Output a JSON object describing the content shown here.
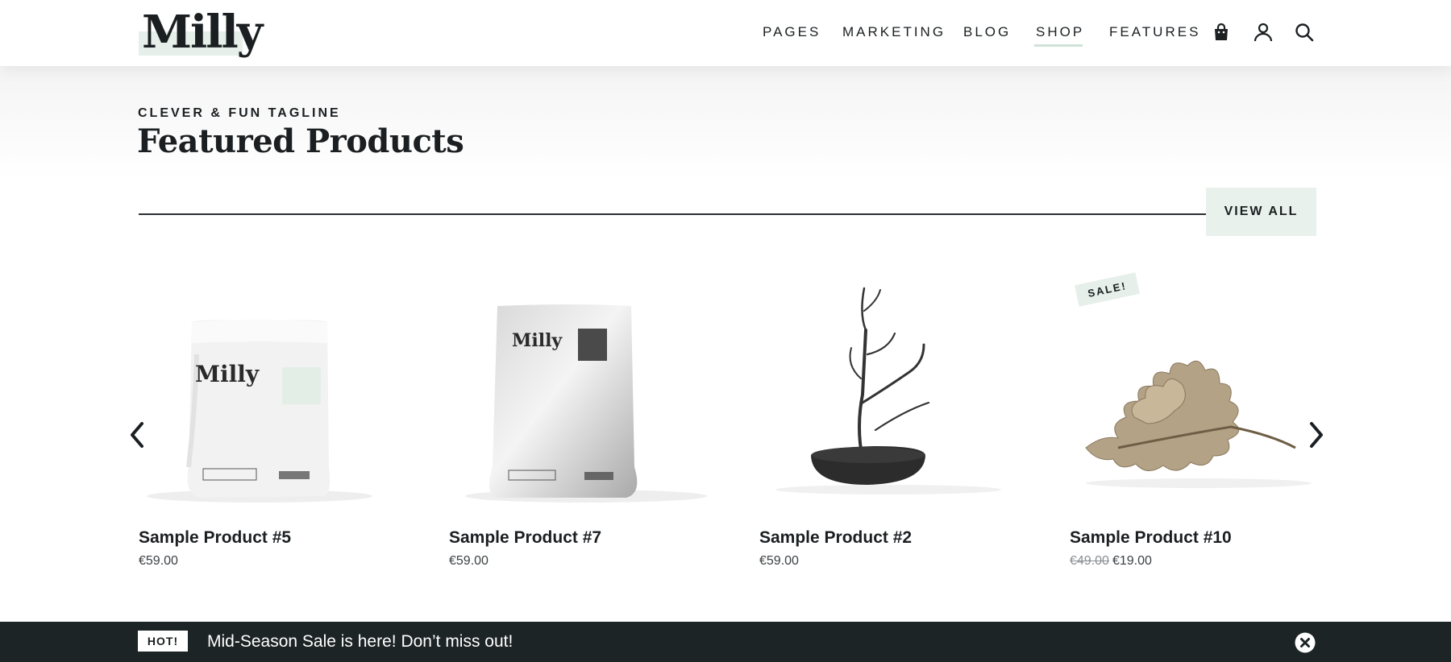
{
  "brand": {
    "logo_text": "Milly"
  },
  "nav": {
    "items": [
      {
        "label": "PAGES",
        "active": false
      },
      {
        "label": "MARKETING",
        "active": false
      },
      {
        "label": "BLOG",
        "active": false
      },
      {
        "label": "SHOP",
        "active": true
      },
      {
        "label": "FEATURES",
        "active": false
      }
    ],
    "icons": [
      "shopping-bag-icon",
      "user-icon",
      "search-icon"
    ]
  },
  "section": {
    "tagline": "CLEVER & FUN TAGLINE",
    "title": "Featured Products",
    "view_all_label": "VIEW ALL"
  },
  "carousel": {
    "prev_icon": "chevron-left-icon",
    "next_icon": "chevron-right-icon"
  },
  "products": [
    {
      "name": "Sample Product #5",
      "price": "€59.00",
      "image": "white-pouch",
      "image_text": "Milly"
    },
    {
      "name": "Sample Product #7",
      "price": "€59.00",
      "image": "silver-pouch",
      "image_text": "Milly"
    },
    {
      "name": "Sample Product #2",
      "price": "€59.00",
      "image": "branch-in-bowl"
    },
    {
      "name": "Sample Product #10",
      "old_price": "€49.00",
      "price": "€19.00",
      "image": "dried-oak-leaf",
      "badge": "SALE!"
    }
  ],
  "notice_bar": {
    "badge": "HOT!",
    "message": "Mid-Season Sale is here! Don’t miss out!",
    "close_icon": "close-circle-icon"
  },
  "colors": {
    "accent_light": "#e6efea",
    "dark": "#1b1f21",
    "bar_bg": "#1d2426"
  }
}
